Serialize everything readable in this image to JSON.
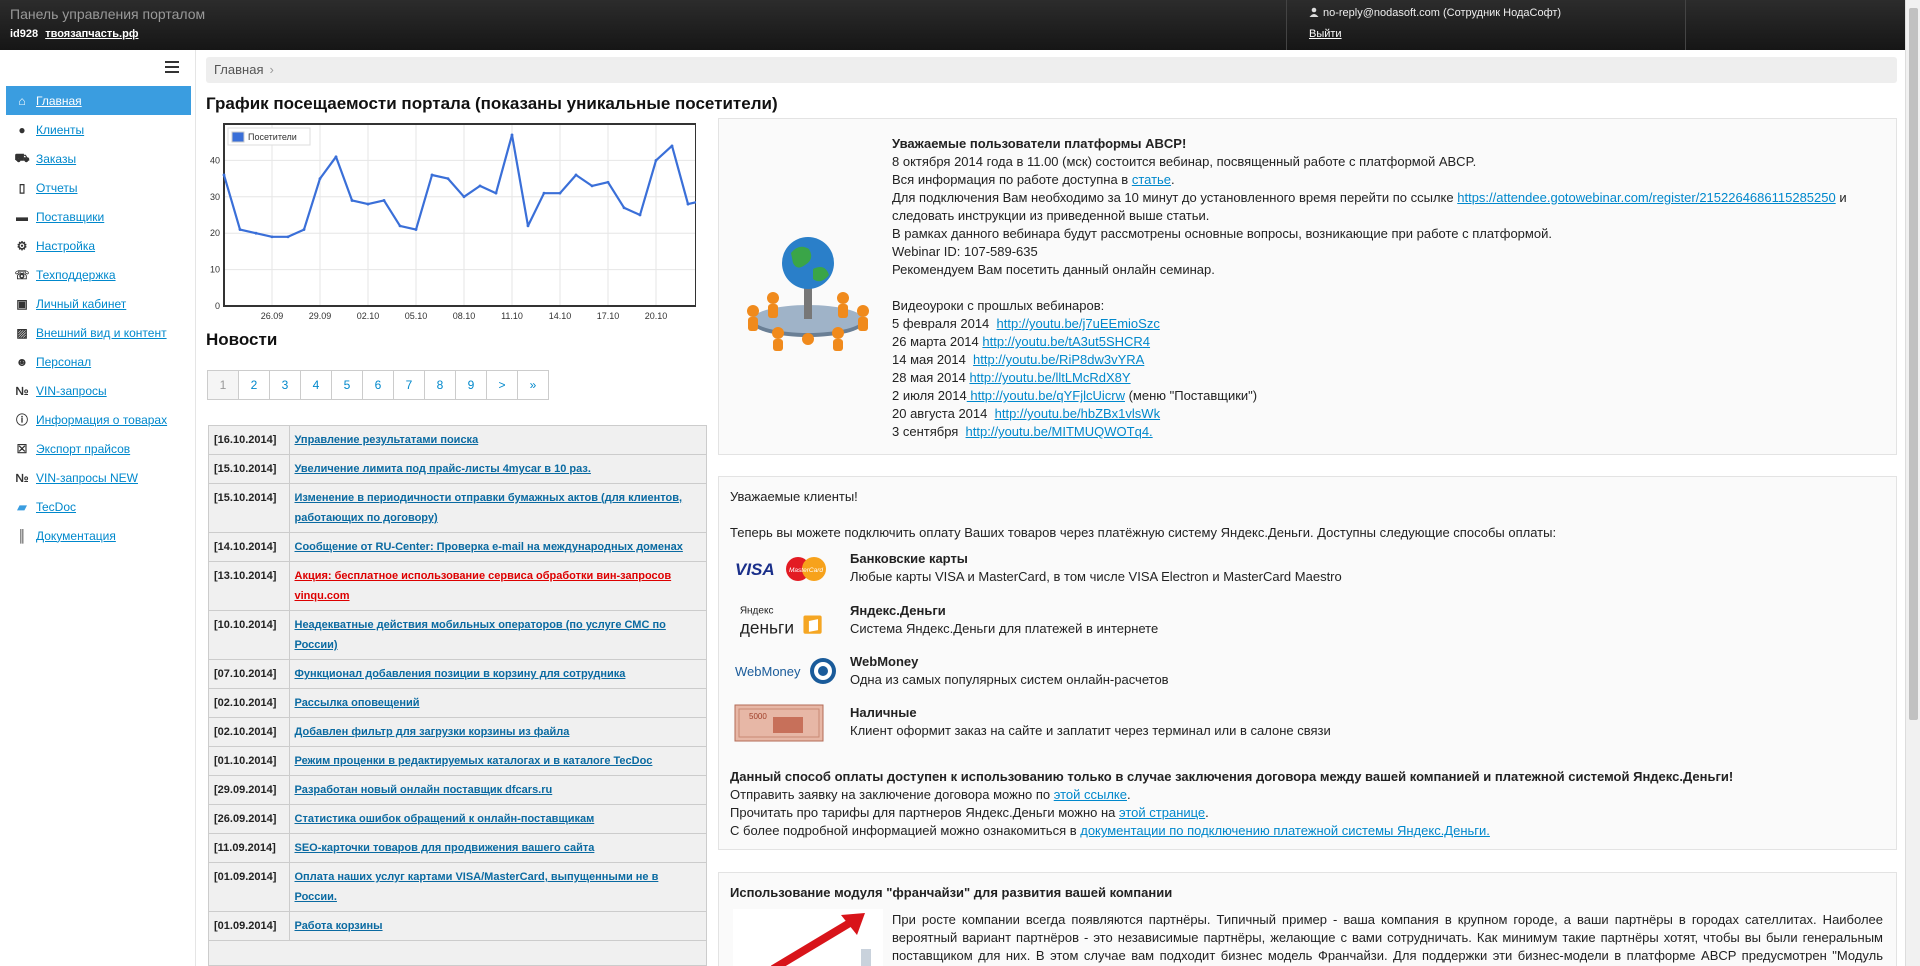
{
  "topbar": {
    "title": "Панель управления порталом",
    "id": "id928",
    "site": "твоязапчасть.рф",
    "user": "no-reply@nodasoft.com (Сотрудник НодаСофт)",
    "logout": "Выйти"
  },
  "sidebar": {
    "items": [
      {
        "label": "Главная",
        "icon": "home-icon"
      },
      {
        "label": "Клиенты",
        "icon": "user-icon"
      },
      {
        "label": "Заказы",
        "icon": "cart-icon"
      },
      {
        "label": "Отчеты",
        "icon": "clipboard-icon"
      },
      {
        "label": "Поставщики",
        "icon": "truck-icon"
      },
      {
        "label": "Настройка",
        "icon": "gear-icon"
      },
      {
        "label": "Техподдержка",
        "icon": "chat-icon"
      },
      {
        "label": "Личный кабинет",
        "icon": "briefcase-icon"
      },
      {
        "label": "Внешний вид и контент",
        "icon": "image-icon"
      },
      {
        "label": "Персонал",
        "icon": "person-icon"
      },
      {
        "label": "VIN-запросы",
        "icon": "number-icon"
      },
      {
        "label": "Информация о товарах",
        "icon": "info-icon"
      },
      {
        "label": "Экспорт прайсов",
        "icon": "excel-icon"
      },
      {
        "label": "VIN-запросы NEW",
        "icon": "number-icon"
      },
      {
        "label": "TecDoc",
        "icon": "folder-icon"
      },
      {
        "label": "Документация",
        "icon": "books-icon"
      }
    ]
  },
  "breadcrumb": {
    "home": "Главная",
    "sep": "›"
  },
  "chart_title": "График посещаемости портала (показаны уникальные посетители)",
  "chart_data": {
    "type": "line",
    "legend": "Посетители",
    "legend_position": "top-left",
    "grid": true,
    "ylim": [
      0,
      50
    ],
    "yticks": [
      "0",
      "10",
      "20",
      "30",
      "40"
    ],
    "xticks": [
      "26.09",
      "29.09",
      "02.10",
      "05.10",
      "08.10",
      "11.10",
      "14.10",
      "17.10",
      "20.10"
    ],
    "xtick_days": [
      3,
      6,
      9,
      12,
      15,
      18,
      21,
      24,
      27
    ],
    "series": [
      {
        "name": "Посетители",
        "color": "#3a6fd8",
        "x": [
          0,
          1,
          2,
          3,
          4,
          5,
          6,
          7,
          8,
          9,
          10,
          11,
          12,
          13,
          14,
          15,
          16,
          17,
          18,
          19,
          20,
          21,
          22,
          23,
          24,
          25,
          26,
          27,
          28,
          29,
          30
        ],
        "values": [
          36,
          21,
          20,
          19,
          19,
          21,
          35,
          41,
          29,
          28,
          29,
          22,
          21,
          36,
          35,
          30,
          33,
          31,
          47,
          22,
          31,
          31,
          36,
          33,
          34,
          27,
          25,
          40,
          44,
          28,
          29
        ]
      }
    ],
    "xdomain": [
      0,
      29.5
    ]
  },
  "news": {
    "title": "Новости",
    "pages": [
      "1",
      "2",
      "3",
      "4",
      "5",
      "6",
      "7",
      "8",
      "9",
      ">",
      "»"
    ],
    "items": [
      {
        "date": "[16.10.2014]",
        "title": "Управление результатами поиска"
      },
      {
        "date": "[15.10.2014]",
        "title": "Увеличение лимита под прайс-листы 4mycar в 10 раз."
      },
      {
        "date": "[15.10.2014]",
        "title": "Изменение в периодичности отправки бумажных актов (для клиентов, работающих по договору)"
      },
      {
        "date": "[14.10.2014]",
        "title": "Сообщение от RU-Center: Проверка e-mail на международных доменах"
      },
      {
        "date": "[13.10.2014]",
        "title": "Акция: бесплатное использование сервиса обработки вин-запросов vinqu.com",
        "red": true
      },
      {
        "date": "[10.10.2014]",
        "title": "Неадекватные действия мобильных операторов (по услуге СМС по России)"
      },
      {
        "date": "[07.10.2014]",
        "title": "Функционал добавления позиции в корзину для сотрудника"
      },
      {
        "date": "[02.10.2014]",
        "title": "Рассылка оповещений"
      },
      {
        "date": "[02.10.2014]",
        "title": "Добавлен фильтр для загрузки корзины из файла"
      },
      {
        "date": "[01.10.2014]",
        "title": "Режим проценки в редактируемых каталогах и в каталоге TecDoc"
      },
      {
        "date": "[29.09.2014]",
        "title": "Разработан новый онлайн поставщик dfcars.ru"
      },
      {
        "date": "[26.09.2014]",
        "title": "Статистика ошибок обращений к онлайн-поставщикам"
      },
      {
        "date": "[11.09.2014]",
        "title": "SEO-карточки товаров для продвижения вашего сайта"
      },
      {
        "date": "[01.09.2014]",
        "title": "Оплата наших услуг картами VISA/MasterCard, выпущенными не в России."
      },
      {
        "date": "[01.09.2014]",
        "title": "Работа корзины"
      }
    ]
  },
  "webinar": {
    "heading": "Уважаемые пользователи платформы ABCP!",
    "l1": " 8 октября 2014 года в 11.00 (мск) состоится вебинар, посвященный  работе с платформой ABCP.",
    "l2a": "Вся информация по работе доступна в ",
    "l2link": "статье",
    "l2b": ".",
    "l3a": "Для подключения Вам необходимо  за  10 минут до установленного время перейти по ссылке ",
    "l3link": "https://attendee.gotowebinar.com/register/2152264686115285250",
    "l3b": " и следовать инструкции из приведенной выше статьи.",
    "l4": "В рамках данного вебинара будут рассмотрены основные вопросы, возникающие при работе с платформой.",
    "l5": "Webinar ID:  107-589-635",
    "l6": "Рекомендуем Вам посетить данный онлайн семинар.",
    "videos_title": "Видеоуроки с прошлых вебинаров:",
    "videos": [
      {
        "date": "5 февраля 2014  ",
        "url": "http://youtu.be/j7uEEmioSzc",
        "note": ""
      },
      {
        "date": "26 марта 2014 ",
        "url": "http://youtu.be/tA3ut5SHCR4",
        "note": ""
      },
      {
        "date": "14 мая 2014  ",
        "url": "http://youtu.be/RiP8dw3vYRA",
        "note": ""
      },
      {
        "date": "28 мая 2014 ",
        "url": "http://youtu.be/lltLMcRdX8Y",
        "note": ""
      },
      {
        "date": "2 июля 2014",
        "url": " http://youtu.be/qYFjlcUicrw",
        "note": " (меню \"Поставщики\")"
      },
      {
        "date": "20 августа 2014  ",
        "url": "http://youtu.be/hbZBx1vlsWk",
        "note": ""
      },
      {
        "date": "3 сентября  ",
        "url": "http://youtu.be/MITMUQWOTq4.",
        "note": ""
      }
    ]
  },
  "payment": {
    "greeting": "Уважаемые клиенты!",
    "intro": "Теперь вы можете подключить оплату Ваших товаров через платёжную систему Яндекс.Деньги. Доступны следующие способы оплаты:",
    "methods": [
      {
        "name": "Банковские карты",
        "desc": "Любые карты VISA и MasterCard, в том числе VISA Electron и MasterCard Maestro",
        "logo": "visa-mastercard-logo",
        "logo_text_1": "VISA",
        "logo_text_2": "MasterCard"
      },
      {
        "name": "Яндекс.Деньги",
        "desc": "Система Яндекс.Деньги для платежей в интернете",
        "logo": "yandex-money-logo",
        "logo_text_1": "Яндекс",
        "logo_text_2": "деньги"
      },
      {
        "name": "WebMoney",
        "desc": "Одна из самых популярных систем онлайн-расчетов",
        "logo": "webmoney-logo",
        "logo_text_1": "WebMoney"
      },
      {
        "name": "Наличные",
        "desc": "Клиент оформит заказ на сайте и заплатит через терминал или в салоне связи",
        "logo": "cash-logo",
        "logo_text_1": "5000"
      }
    ],
    "notice": "Данный способ оплаты доступен к использованию только в случае заключения договора между вашей компанией и платежной системой Яндекс.Деньги!",
    "r1a": "Отправить заявку на заключение договора можно по ",
    "r1link": "этой ссылке",
    "r1b": ".",
    "r2a": "Прочитать про тарифы для партнеров Яндекс.Деньги можно на ",
    "r2link": "этой странице",
    "r2b": ".",
    "r3a": "С более подробной информацией можно ознакомиться в ",
    "r3link": "документации по подключению платежной системы Яндекс.Деньги."
  },
  "franchise": {
    "title": "Использование модуля \"франчайзи\" для развития вашей компании",
    "text": "При росте компании всегда появляются партнёры. Типичный пример - ваша компания в крупном городе, а ваши партнёры в городах сателлитах. Наиболее вероятный вариант партнёров - это независимые партнёры, желающие с вами сотрудничать. Как минимум такие партнёры хотят, чтобы вы были генеральным поставщиком для них. В этом случае вам подходит бизнес модель Франчайзи. Для поддержки эти бизнес-модели в платформе ABCP предусмотрен \"Модуль франчайзи\"."
  }
}
